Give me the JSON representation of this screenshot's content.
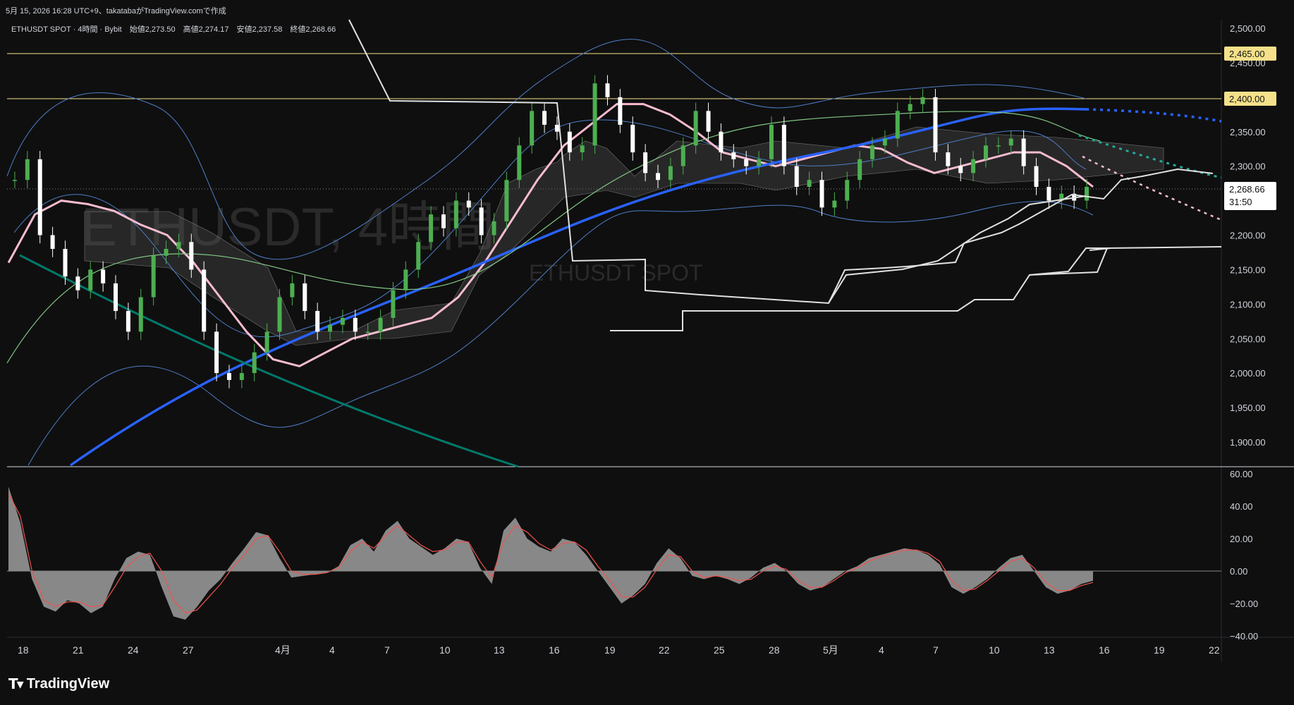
{
  "header": {
    "datetime_author": "5月 15, 2026 16:28 UTC+9、takatabaがTradingView.comで作成"
  },
  "legend": {
    "symbol_line": "ETHUSDT SPOT · 4時間 · Bybit",
    "open_label": "始値",
    "open_value": "2,273.50",
    "high_label": "高値",
    "high_value": "2,274.17",
    "low_label": "安値",
    "low_value": "2,237.58",
    "close_label": "終値",
    "close_value": "2,268.66"
  },
  "watermark": {
    "main": "ETHUSDT, 4時間",
    "sub": "ETHUSDT SPOT"
  },
  "price_badges": {
    "level_upper": "2,465.00",
    "level_lower": "2,400.00",
    "last_price": "2,268.66",
    "countdown": "31:50"
  },
  "colors": {
    "background": "#0f0f0f",
    "text": "#d1d4dc",
    "candle_up": "#4caf50",
    "candle_down": "#ffffff",
    "sma_long": "#2962ff",
    "sma_mid": "#f8bbd0",
    "sma_green": "#81c784",
    "sma_teal": "#00796b",
    "bollinger": "#4f7ec9",
    "level_line": "#f5e18a",
    "cloud": "#555555",
    "oscillator_fill": "#9e9e9e",
    "oscillator_signal": "#ef5350"
  },
  "brand": {
    "name": "TradingView"
  },
  "chart_data": [
    {
      "type": "line",
      "title": "ETHUSDT SPOT · 4時間 · Bybit",
      "x_ticks": [
        "18",
        "21",
        "24",
        "27",
        "4月",
        "4",
        "7",
        "10",
        "13",
        "16",
        "19",
        "22",
        "25",
        "28",
        "5月",
        "4",
        "7",
        "10",
        "13",
        "16",
        "19",
        "22"
      ],
      "y_ticks": [
        "2,500.00",
        "2,450.00",
        "2,400.00",
        "2,350.00",
        "2,300.00",
        "2,250.00",
        "2,200.00",
        "2,150.00",
        "2,100.00",
        "2,050.00",
        "2,000.00",
        "1,950.00",
        "1,900.00"
      ],
      "ylim": [
        1875,
        2520
      ],
      "horizontal_levels": [
        2465,
        2400
      ],
      "last_price": 2268.66,
      "grid": false,
      "series": [
        {
          "values": [
            2280,
            2310,
            2200,
            2180,
            2140,
            2120,
            2150,
            2130,
            2090,
            2060,
            2110,
            2170,
            2180,
            2190,
            2150,
            2060,
            2000,
            1990,
            2000,
            2030,
            2060,
            2110,
            2130,
            2090,
            2060,
            2070,
            2080,
            2060,
            2060,
            2080,
            2120,
            2150,
            2190,
            2230,
            2210,
            2250,
            2240,
            2200,
            2220,
            2280,
            2330,
            2380,
            2360,
            2350,
            2320,
            2330,
            2420,
            2400,
            2360,
            2320,
            2290,
            2280,
            2300,
            2330,
            2380,
            2350,
            2320,
            2310,
            2300,
            2310,
            2360,
            2300,
            2270,
            2280,
            2240,
            2250,
            2280,
            2310,
            2330,
            2340,
            2380,
            2390,
            2400,
            2320,
            2300,
            2290,
            2310,
            2330,
            2330,
            2340,
            2300,
            2270,
            2250,
            2260,
            2250,
            2270
          ]
        },
        {
          "name": "",
          "values": [
            2160,
            2230,
            2250,
            2245,
            2235,
            2215,
            2200,
            2160,
            2110,
            2060,
            2020,
            2010,
            2030,
            2050,
            2060,
            2070,
            2080,
            2110,
            2160,
            2220,
            2280,
            2330,
            2360,
            2390,
            2390,
            2375,
            2350,
            2320,
            2310,
            2300,
            2310,
            2320,
            2330,
            2325,
            2305,
            2290,
            2300,
            2310,
            2320,
            2320,
            2300,
            2270
          ]
        }
      ]
    },
    {
      "type": "area",
      "title": "",
      "y_ticks": [
        "60.00",
        "40.00",
        "20.00",
        "0.00",
        "−20.00",
        "−40.00"
      ],
      "ylim": [
        -40,
        60
      ],
      "series": [
        {
          "values": [
            52,
            30,
            -5,
            -22,
            -25,
            -18,
            -20,
            -26,
            -22,
            -5,
            8,
            12,
            10,
            -10,
            -28,
            -30,
            -22,
            -12,
            -5,
            5,
            14,
            24,
            22,
            8,
            -4,
            -3,
            -2,
            -1,
            3,
            16,
            20,
            12,
            25,
            31,
            20,
            15,
            10,
            14,
            20,
            18,
            2,
            -8,
            25,
            33,
            20,
            15,
            12,
            20,
            18,
            10,
            0,
            -10,
            -20,
            -15,
            -8,
            5,
            14,
            8,
            -3,
            -5,
            -3,
            -5,
            -8,
            -4,
            2,
            5,
            0,
            -8,
            -12,
            -10,
            -5,
            0,
            3,
            8,
            10,
            12,
            14,
            13,
            10,
            4,
            -10,
            -14,
            -10,
            -5,
            2,
            8,
            10,
            0,
            -10,
            -14,
            -12,
            -8,
            -6
          ]
        },
        {
          "name": "",
          "values": [
            48,
            34,
            0,
            -18,
            -22,
            -19,
            -19,
            -22,
            -21,
            -10,
            2,
            9,
            11,
            0,
            -18,
            -26,
            -24,
            -16,
            -8,
            2,
            10,
            20,
            22,
            12,
            0,
            -2,
            -2,
            -1,
            2,
            12,
            18,
            14,
            22,
            28,
            22,
            16,
            12,
            13,
            18,
            18,
            6,
            -4,
            18,
            28,
            24,
            17,
            13,
            17,
            18,
            13,
            3,
            -6,
            -16,
            -16,
            -10,
            1,
            10,
            9,
            0,
            -4,
            -3,
            -4,
            -6,
            -5,
            0,
            3,
            1,
            -6,
            -10,
            -10,
            -6,
            -1,
            2,
            6,
            9,
            11,
            13,
            13,
            11,
            6,
            -6,
            -12,
            -11,
            -6,
            0,
            6,
            8,
            2,
            -7,
            -12,
            -12,
            -9,
            -7
          ]
        }
      ]
    }
  ]
}
